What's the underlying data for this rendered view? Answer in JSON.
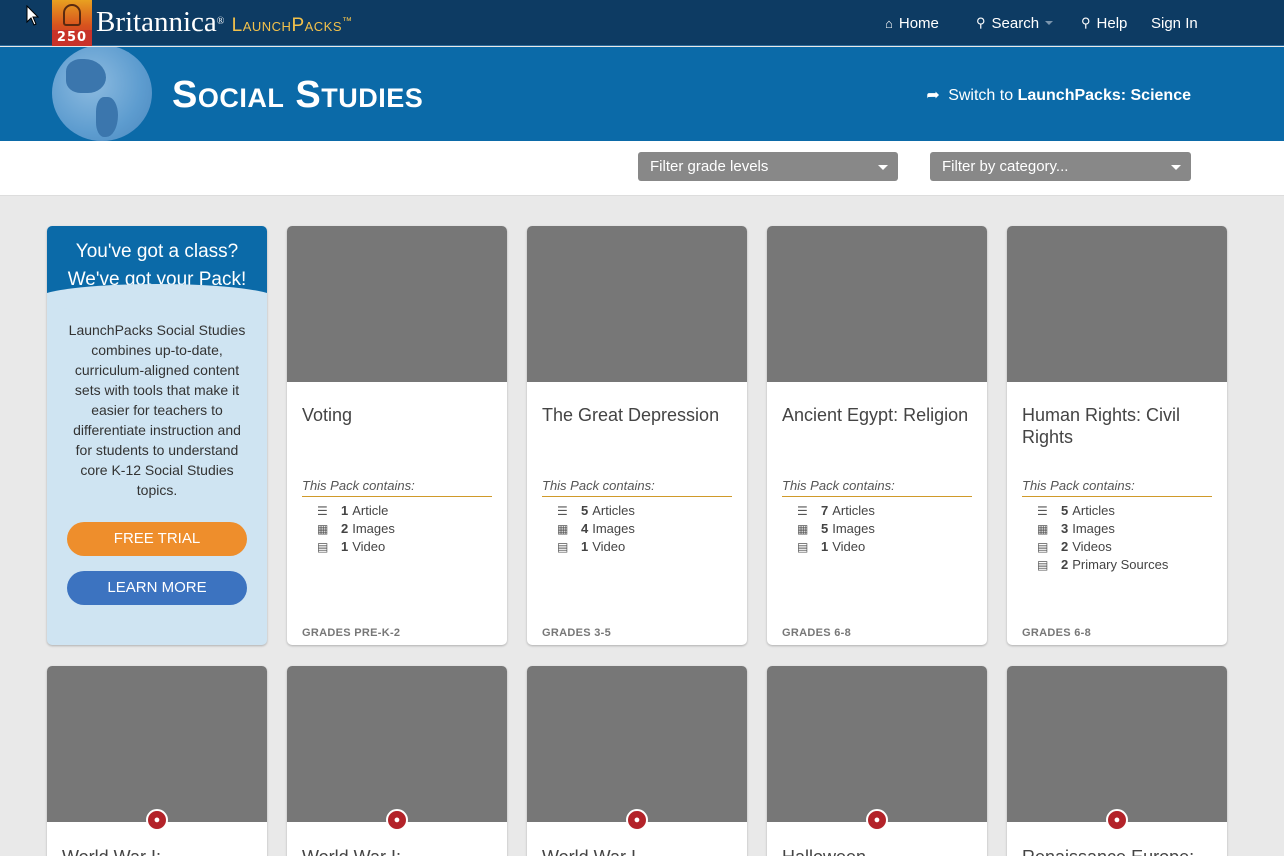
{
  "header": {
    "badge_number": "250",
    "brand_name": "Britannica",
    "brand_reg": "®",
    "product_name": "LaunchPacks",
    "product_tm": "™",
    "nav": {
      "home": "Home",
      "search": "Search",
      "help": "Help",
      "sign_in": "Sign In"
    }
  },
  "banner": {
    "title": "Social Studies",
    "switch_prefix": "Switch to",
    "switch_target": "LaunchPacks: Science"
  },
  "filters": {
    "grade": "Filter grade levels",
    "category": "Filter by category..."
  },
  "promo": {
    "headline_1": "You've got a class?",
    "headline_2": "We've got your Pack!",
    "body": "LaunchPacks Social Studies combines up-to-date, curriculum-aligned content sets with tools that make it easier for teachers to differentiate instruction and for students to understand core K-12 Social Studies topics.",
    "free_trial": "FREE TRIAL",
    "learn_more": "LEARN MORE"
  },
  "pack_contains_label": "This Pack contains:",
  "cards": [
    {
      "title": "Voting",
      "items": [
        {
          "icon": "list-icon",
          "count": "1",
          "label": "Article"
        },
        {
          "icon": "image-icon",
          "count": "2",
          "label": "Images"
        },
        {
          "icon": "film-icon",
          "count": "1",
          "label": "Video"
        }
      ],
      "grades": "GRADES PRE-K-2"
    },
    {
      "title": "The Great Depression",
      "items": [
        {
          "icon": "list-icon",
          "count": "5",
          "label": "Articles"
        },
        {
          "icon": "image-icon",
          "count": "4",
          "label": "Images"
        },
        {
          "icon": "film-icon",
          "count": "1",
          "label": "Video"
        }
      ],
      "grades": "GRADES 3-5"
    },
    {
      "title": "Ancient Egypt: Religion",
      "items": [
        {
          "icon": "list-icon",
          "count": "7",
          "label": "Articles"
        },
        {
          "icon": "image-icon",
          "count": "5",
          "label": "Images"
        },
        {
          "icon": "film-icon",
          "count": "1",
          "label": "Video"
        }
      ],
      "grades": "GRADES 6-8"
    },
    {
      "title": "Human Rights: Civil Rights",
      "items": [
        {
          "icon": "list-icon",
          "count": "5",
          "label": "Articles"
        },
        {
          "icon": "image-icon",
          "count": "3",
          "label": "Images"
        },
        {
          "icon": "film-icon",
          "count": "2",
          "label": "Videos"
        },
        {
          "icon": "document-icon",
          "count": "2",
          "label": "Primary Sources"
        }
      ],
      "grades": "GRADES 6-8"
    }
  ],
  "locked_cards": [
    {
      "title": "World War I:"
    },
    {
      "title": "World War I:"
    },
    {
      "title": "World War I"
    },
    {
      "title": "Halloween"
    },
    {
      "title": "Renaissance Europe:"
    }
  ],
  "colors": {
    "nav_bg": "#0d3b63",
    "banner_bg": "#0b6aa8",
    "free_trial": "#ee8e2c",
    "learn_more": "#3c73c0",
    "lock": "#b3232a",
    "divider": "#d09a2a"
  }
}
